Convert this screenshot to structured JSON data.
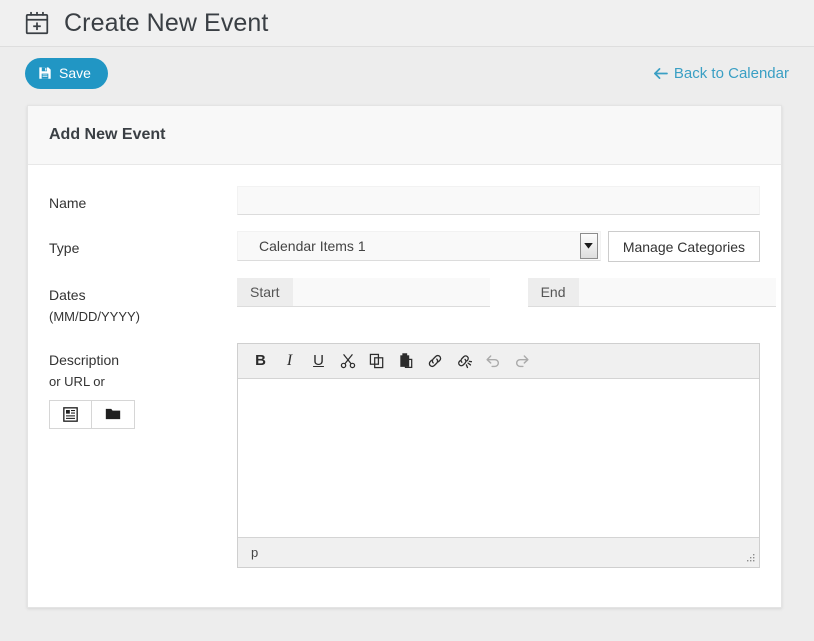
{
  "header": {
    "icon": "calendar-plus-icon",
    "title": "Create New Event"
  },
  "actions": {
    "save_label": "Save",
    "save_icon": "floppy-disk-icon",
    "back_label": "Back to Calendar",
    "back_icon": "arrow-left-icon",
    "accent_color": "#2196c4",
    "link_color": "#3a9fc4"
  },
  "card": {
    "title": "Add New Event"
  },
  "form": {
    "name": {
      "label": "Name",
      "value": "",
      "placeholder": ""
    },
    "type": {
      "label": "Type",
      "selected": "Calendar Items 1",
      "options": [
        "Calendar Items 1"
      ],
      "manage_button": "Manage Categories"
    },
    "dates": {
      "label": "Dates",
      "sublabel": "(MM/DD/YYYY)",
      "start_addon": "Start",
      "start_value": "",
      "end_addon": "End",
      "end_value": ""
    },
    "description": {
      "label": "Description",
      "sublabel": "or URL or",
      "buttons": [
        {
          "name": "insert-content-icon",
          "title": "Insert Content"
        },
        {
          "name": "folder-icon",
          "title": "Browse Files"
        }
      ]
    }
  },
  "editor": {
    "toolbar": [
      {
        "name": "bold-icon",
        "label": "B",
        "kind": "b",
        "disabled": false
      },
      {
        "name": "italic-icon",
        "label": "I",
        "kind": "i",
        "disabled": false
      },
      {
        "name": "underline-icon",
        "label": "U",
        "kind": "u",
        "disabled": false
      },
      {
        "name": "cut-icon",
        "label": "",
        "kind": "svg-cut",
        "disabled": false
      },
      {
        "name": "copy-icon",
        "label": "",
        "kind": "svg-copy",
        "disabled": false
      },
      {
        "name": "paste-icon",
        "label": "",
        "kind": "svg-paste",
        "disabled": false
      },
      {
        "name": "link-icon",
        "label": "",
        "kind": "svg-link",
        "disabled": false
      },
      {
        "name": "unlink-icon",
        "label": "",
        "kind": "svg-unlink",
        "disabled": false
      },
      {
        "name": "undo-icon",
        "label": "",
        "kind": "svg-undo",
        "disabled": true
      },
      {
        "name": "redo-icon",
        "label": "",
        "kind": "svg-redo",
        "disabled": true
      }
    ],
    "content": "",
    "status_path": "p",
    "resize_grip": "resize-grip-icon"
  }
}
